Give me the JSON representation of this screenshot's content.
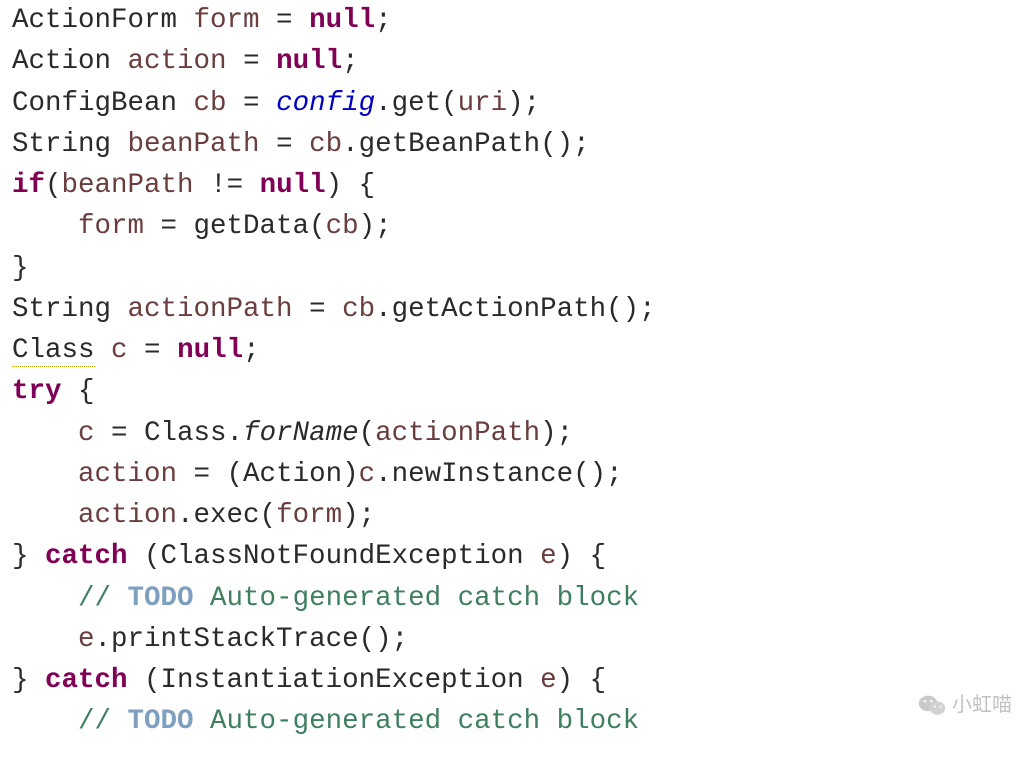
{
  "code": {
    "lines": [
      [
        {
          "t": "ActionForm ",
          "c": "txt"
        },
        {
          "t": "form",
          "c": "par"
        },
        {
          "t": " = ",
          "c": "txt"
        },
        {
          "t": "null",
          "c": "kw"
        },
        {
          "t": ";",
          "c": "txt"
        }
      ],
      [
        {
          "t": "Action ",
          "c": "txt"
        },
        {
          "t": "action",
          "c": "par"
        },
        {
          "t": " = ",
          "c": "txt"
        },
        {
          "t": "null",
          "c": "kw"
        },
        {
          "t": ";",
          "c": "txt"
        }
      ],
      [
        {
          "t": "ConfigBean ",
          "c": "txt"
        },
        {
          "t": "cb",
          "c": "par"
        },
        {
          "t": " = ",
          "c": "txt"
        },
        {
          "t": "config",
          "c": "fld"
        },
        {
          "t": ".get(",
          "c": "txt"
        },
        {
          "t": "uri",
          "c": "par"
        },
        {
          "t": ");",
          "c": "txt"
        }
      ],
      [
        {
          "t": "String ",
          "c": "txt"
        },
        {
          "t": "beanPath",
          "c": "par"
        },
        {
          "t": " = ",
          "c": "txt"
        },
        {
          "t": "cb",
          "c": "par"
        },
        {
          "t": ".getBeanPath();",
          "c": "txt"
        }
      ],
      [
        {
          "t": "if",
          "c": "kw"
        },
        {
          "t": "(",
          "c": "txt"
        },
        {
          "t": "beanPath",
          "c": "par"
        },
        {
          "t": " != ",
          "c": "txt"
        },
        {
          "t": "null",
          "c": "kw"
        },
        {
          "t": ") {",
          "c": "txt"
        }
      ],
      [
        {
          "t": "    ",
          "c": "txt"
        },
        {
          "t": "form",
          "c": "par"
        },
        {
          "t": " = getData(",
          "c": "txt"
        },
        {
          "t": "cb",
          "c": "par"
        },
        {
          "t": ");",
          "c": "txt"
        }
      ],
      [
        {
          "t": "}",
          "c": "txt"
        }
      ],
      [
        {
          "t": "String ",
          "c": "txt"
        },
        {
          "t": "actionPath",
          "c": "par"
        },
        {
          "t": " = ",
          "c": "txt"
        },
        {
          "t": "cb",
          "c": "par"
        },
        {
          "t": ".getActionPath();",
          "c": "txt"
        }
      ],
      [
        {
          "t": "Class",
          "c": "txt warn"
        },
        {
          "t": " ",
          "c": "txt"
        },
        {
          "t": "c",
          "c": "par"
        },
        {
          "t": " = ",
          "c": "txt"
        },
        {
          "t": "null",
          "c": "kw"
        },
        {
          "t": ";",
          "c": "txt"
        }
      ],
      [
        {
          "t": "try",
          "c": "kw"
        },
        {
          "t": " {",
          "c": "txt"
        }
      ],
      [
        {
          "t": "    ",
          "c": "txt"
        },
        {
          "t": "c",
          "c": "par"
        },
        {
          "t": " = Class.",
          "c": "txt"
        },
        {
          "t": "forName",
          "c": "sti"
        },
        {
          "t": "(",
          "c": "txt"
        },
        {
          "t": "actionPath",
          "c": "par"
        },
        {
          "t": ");",
          "c": "txt"
        }
      ],
      [
        {
          "t": "    ",
          "c": "txt"
        },
        {
          "t": "action",
          "c": "par"
        },
        {
          "t": " = (Action)",
          "c": "txt"
        },
        {
          "t": "c",
          "c": "par"
        },
        {
          "t": ".newInstance();",
          "c": "txt"
        }
      ],
      [
        {
          "t": "    ",
          "c": "txt"
        },
        {
          "t": "action",
          "c": "par"
        },
        {
          "t": ".exec(",
          "c": "txt"
        },
        {
          "t": "form",
          "c": "par"
        },
        {
          "t": ");",
          "c": "txt"
        }
      ],
      [
        {
          "t": "} ",
          "c": "txt"
        },
        {
          "t": "catch",
          "c": "kw"
        },
        {
          "t": " (ClassNotFoundException ",
          "c": "txt"
        },
        {
          "t": "e",
          "c": "par"
        },
        {
          "t": ") {",
          "c": "txt"
        }
      ],
      [
        {
          "t": "    ",
          "c": "txt"
        },
        {
          "t": "// ",
          "c": "cmt"
        },
        {
          "t": "TODO",
          "c": "todo"
        },
        {
          "t": " Auto-generated catch block",
          "c": "cmt"
        }
      ],
      [
        {
          "t": "    ",
          "c": "txt"
        },
        {
          "t": "e",
          "c": "par"
        },
        {
          "t": ".printStackTrace();",
          "c": "txt"
        }
      ],
      [
        {
          "t": "} ",
          "c": "txt"
        },
        {
          "t": "catch",
          "c": "kw"
        },
        {
          "t": " (InstantiationException ",
          "c": "txt"
        },
        {
          "t": "e",
          "c": "par"
        },
        {
          "t": ") {",
          "c": "txt"
        }
      ],
      [
        {
          "t": "    ",
          "c": "txt"
        },
        {
          "t": "// ",
          "c": "cmt"
        },
        {
          "t": "TODO",
          "c": "todo"
        },
        {
          "t": " Auto-generated catch block",
          "c": "cmt"
        }
      ]
    ]
  },
  "watermark": {
    "text": "小虹喵"
  }
}
